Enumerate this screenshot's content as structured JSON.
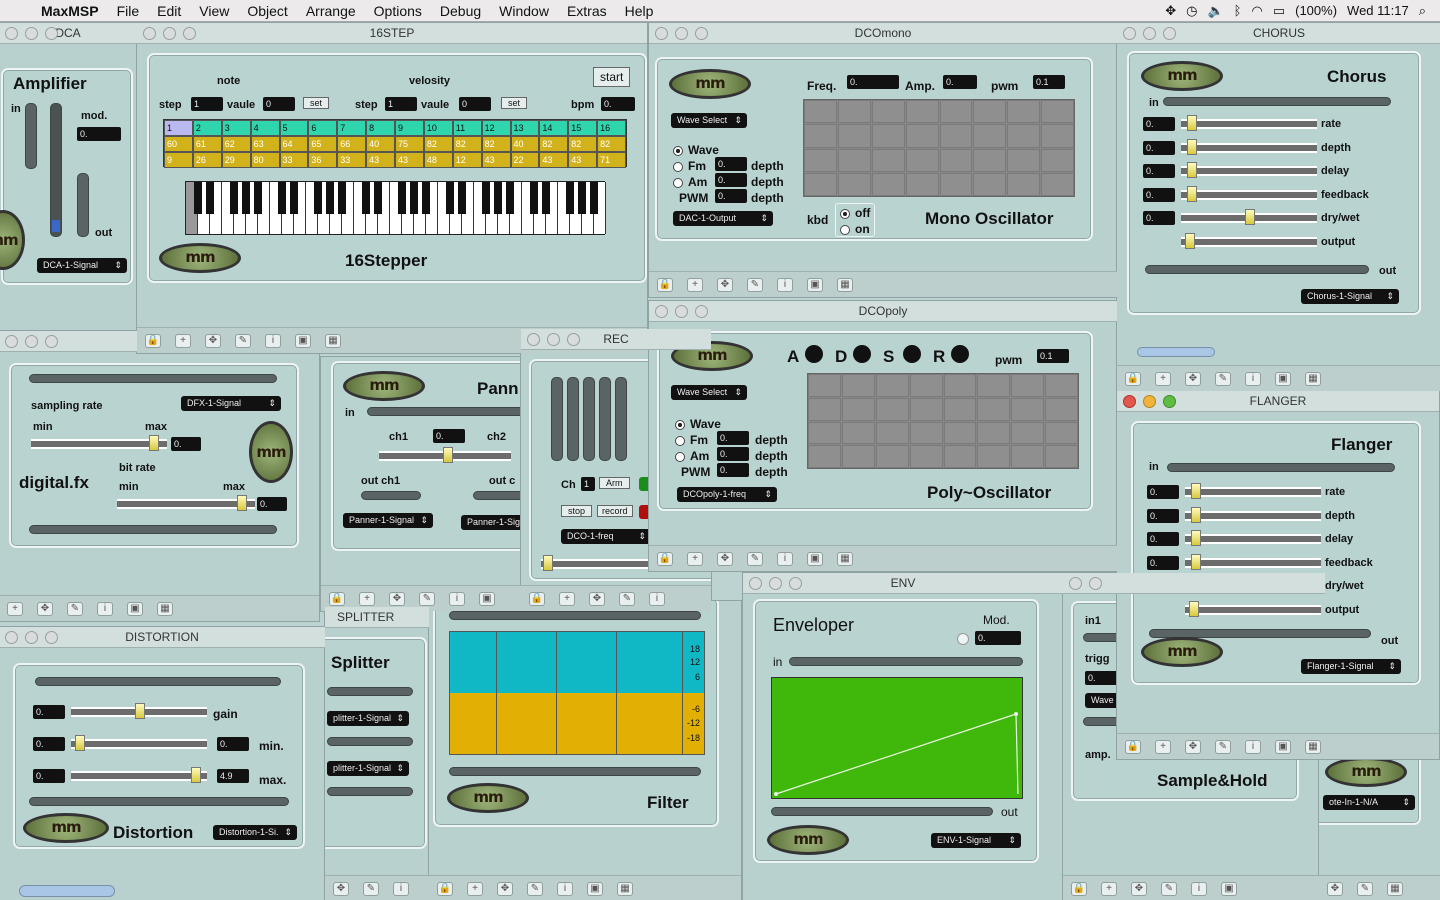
{
  "menubar": {
    "app": "MaxMSP",
    "items": [
      "File",
      "Edit",
      "View",
      "Object",
      "Arrange",
      "Options",
      "Debug",
      "Window",
      "Extras",
      "Help"
    ],
    "battery": "(100%)",
    "clock": "Wed 11:17"
  },
  "windows": {
    "dca": {
      "title": "DCA",
      "heading": "Amplifier",
      "in": "in",
      "mod": "mod.",
      "mod_value": "0.",
      "out": "out",
      "menu": "DCA-1-Signal"
    },
    "step": {
      "title": "16STEP",
      "note": "note",
      "velocity": "velosity",
      "step": "step",
      "value": "vaule",
      "step_val": "1",
      "vaule_val": "0",
      "set": "set",
      "start": "start",
      "bpm": "bpm",
      "bpm_val": "0.",
      "name": "16Stepper",
      "steps": [
        "1",
        "2",
        "3",
        "4",
        "5",
        "6",
        "7",
        "8",
        "9",
        "10",
        "11",
        "12",
        "13",
        "14",
        "15",
        "16"
      ],
      "notes": [
        "60",
        "61",
        "62",
        "63",
        "64",
        "65",
        "66",
        "40",
        "75",
        "82",
        "82",
        "82",
        "40",
        "82",
        "82",
        "82"
      ],
      "vels": [
        "9",
        "26",
        "29",
        "80",
        "33",
        "36",
        "33",
        "43",
        "43",
        "48",
        "12",
        "43",
        "22",
        "43",
        "43",
        "71"
      ]
    },
    "dcomono": {
      "title": "DCOmono",
      "freq": "Freq.",
      "freq_val": "0.",
      "amp": "Amp.",
      "amp_val": "0.",
      "pwm": "pwm",
      "pwm_val": "0.1",
      "wave_select": "Wave Select",
      "wave": "Wave",
      "fm": "Fm",
      "am": "Am",
      "pwm_cap": "PWM",
      "depth": "depth",
      "depth_val": "0.",
      "out_menu": "DAC-1-Output",
      "kbd": "kbd",
      "off": "off",
      "on": "on",
      "name": "Mono Oscillator"
    },
    "dcopoly": {
      "title": "DCOpoly",
      "a": "A",
      "d": "D",
      "s": "S",
      "r": "R",
      "pwm": "pwm",
      "pwm_val": "0.1",
      "wave_select": "Wave Select",
      "wave": "Wave",
      "fm": "Fm",
      "am": "Am",
      "pwm_cap": "PWM",
      "depth": "depth",
      "depth_val": "0.",
      "freq_menu": "DCOpoly-1-freq",
      "name": "Poly~Oscillator"
    },
    "chorus": {
      "title": "CHORUS",
      "heading": "Chorus",
      "in": "in",
      "out": "out",
      "params": [
        "rate",
        "depth",
        "delay",
        "feedback",
        "dry/wet",
        "output"
      ],
      "value": "0.",
      "menu": "Chorus-1-Signal"
    },
    "flanger": {
      "title": "FLANGER",
      "heading": "Flanger",
      "in": "in",
      "out": "out",
      "params": [
        "rate",
        "depth",
        "delay",
        "feedback",
        "dry/wet",
        "output"
      ],
      "value": "0.",
      "menu": "Flanger-1-Signal"
    },
    "dfx": {
      "sampling_rate": "sampling rate",
      "menu": "DFX-1-Signal",
      "min": "min",
      "max": "max",
      "max_val": "0.",
      "bit_rate": "bit rate",
      "bit_max_val": "0.",
      "name": "digital.fx"
    },
    "pan": {
      "heading": "Pann",
      "in": "in",
      "ch1": "ch1",
      "ch2": "ch2",
      "val": "0.",
      "out_ch1": "out ch1",
      "out_c": "out c",
      "menu1": "Panner-1-Signal",
      "menu2": "Panner-1-Sig"
    },
    "rec": {
      "title": "REC",
      "ch": "Ch",
      "ch_val": "1",
      "arm": "Arm",
      "stop": "stop",
      "record": "record",
      "menu": "DCO-1-freq"
    },
    "distortion": {
      "title": "DISTORTION",
      "gain": "gain",
      "min": "min.",
      "max": "max.",
      "val": "0.",
      "max_val": "4.9",
      "name": "Distortion",
      "menu": "Distortion-1-Si."
    },
    "splitter": {
      "title": "SPLITTER",
      "heading": "Splitter",
      "menu1": "plitter-1-Signal",
      "menu2": "plitter-1-Signal"
    },
    "filter": {
      "name": "Filter",
      "ticks_top": [
        "18",
        "12",
        "6"
      ],
      "ticks_bot": [
        "-6",
        "-12",
        "-18"
      ]
    },
    "env": {
      "title": "ENV",
      "heading": "Enveloper",
      "mod": "Mod.",
      "mod_val": "0.",
      "in": "in",
      "out": "out",
      "menu": "ENV-1-Signal"
    },
    "sh": {
      "in1": "in1",
      "trigg": "trigg",
      "val": "0.",
      "wave": "Wave S",
      "amp": "amp.",
      "name": "Sample&Hold"
    },
    "notein": {
      "menu": "ote-In-1-N/A"
    }
  },
  "colors": {
    "desk": "#bcd3d1",
    "step_cell": "#2fd6ad",
    "note_cell": "#d2b21a",
    "env_bg": "#3fb70b",
    "filter_top": "#10b8c6",
    "filter_bot": "#e2b005"
  }
}
